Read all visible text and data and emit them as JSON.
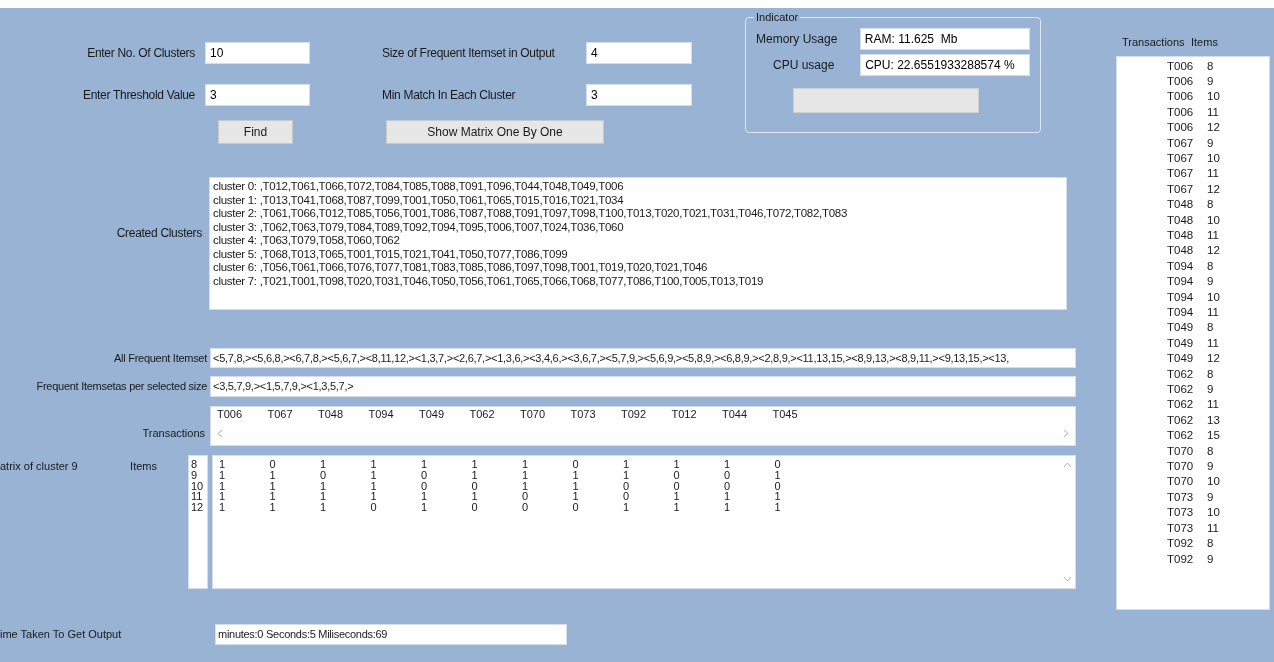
{
  "form": {
    "fields": [
      {
        "label": "Enter No. Of Clusters",
        "value": "10"
      },
      {
        "label": "Size of Frequent Itemset in Output",
        "value": "4"
      },
      {
        "label": "Enter Threshold Value",
        "value": "3"
      },
      {
        "label": "Min Match In Each Cluster",
        "value": "3"
      }
    ],
    "buttons": [
      "Find",
      "Show Matrix One By One"
    ]
  },
  "indicator": {
    "title": "Indicator",
    "memory_label": "Memory Usage",
    "memory_value": "RAM: 11.625  Mb",
    "cpu_label": "CPU usage",
    "cpu_value": "CPU: 22.6551933288574 %",
    "progress": {
      "level": 0
    }
  },
  "clusters": {
    "label": "Created Clusters",
    "lines": [
      "cluster 0: ,T012,T061,T066,T072,T084,T085,T088,T091,T096,T044,T048,T049,T006",
      "cluster 1: ,T013,T041,T068,T087,T099,T001,T050,T061,T065,T015,T016,T021,T034",
      "cluster 2: ,T061,T066,T012,T085,T056,T001,T086,T087,T088,T091,T097,T098,T100,T013,T020,T021,T031,T046,T072,T082,T083",
      "cluster 3: ,T062,T063,T079,T084,T089,T092,T094,T095,T006,T007,T024,T036,T060",
      "cluster 4: ,T063,T079,T058,T060,T062",
      "cluster 5: ,T068,T013,T065,T001,T015,T021,T041,T050,T077,T086,T099",
      "cluster 6: ,T056,T061,T066,T076,T077,T081,T083,T085,T086,T097,T098,T001,T019,T020,T021,T046",
      "cluster 7: ,T021,T001,T098,T020,T031,T046,T050,T056,T061,T065,T066,T068,T077,T086,T100,T005,T013,T019"
    ]
  },
  "all_frequent": {
    "label": "All Frequent Itemset",
    "value": "<5,7,8,><5,6,8,><6,7,8,><5,6,7,><8,11,12,><1,3,7,><2,6,7,><1,3,6,><3,4,6,><3,6,7,><5,7,9,><5,6,9,><5,8,9,><6,8,9,><2,8,9,><11,13,15,><8,9,13,><8,9,11,><9,13,15,><13,"
  },
  "selected_size": {
    "label": "Frequent Itemsetas per selected size",
    "value": "<3,5,7,9,><1,5,7,9,><1,3,5,7,>"
  },
  "transactions": {
    "label": "Transactions",
    "columns": [
      "T006",
      "T067",
      "T048",
      "T094",
      "T049",
      "T062",
      "T070",
      "T073",
      "T092",
      "T012",
      "T044",
      "T045"
    ]
  },
  "matrix": {
    "label": "atrix of cluster 9",
    "items_label": "Items",
    "items": [
      "8",
      "9",
      "10",
      "11",
      "12"
    ],
    "rows": [
      [
        "1",
        "0",
        "1",
        "1",
        "1",
        "1",
        "1",
        "0",
        "1",
        "1",
        "1",
        "0"
      ],
      [
        "1",
        "1",
        "0",
        "1",
        "0",
        "1",
        "1",
        "1",
        "1",
        "0",
        "0",
        "1"
      ],
      [
        "1",
        "1",
        "1",
        "1",
        "0",
        "0",
        "1",
        "1",
        "0",
        "0",
        "0",
        "0"
      ],
      [
        "1",
        "1",
        "1",
        "1",
        "1",
        "1",
        "0",
        "1",
        "0",
        "1",
        "1",
        "1"
      ],
      [
        "1",
        "1",
        "1",
        "0",
        "1",
        "0",
        "0",
        "0",
        "1",
        "1",
        "1",
        "1"
      ]
    ]
  },
  "time": {
    "label": "ime Taken To Get Output",
    "value": "minutes:0 Seconds:5 Miliseconds:69"
  },
  "transaction_list": {
    "headers": [
      "Transactions",
      "Items"
    ],
    "rows": [
      [
        "T006",
        "8"
      ],
      [
        "T006",
        "9"
      ],
      [
        "T006",
        "10"
      ],
      [
        "T006",
        "11"
      ],
      [
        "T006",
        "12"
      ],
      [
        "T067",
        "9"
      ],
      [
        "T067",
        "10"
      ],
      [
        "T067",
        "11"
      ],
      [
        "T067",
        "12"
      ],
      [
        "T048",
        "8"
      ],
      [
        "T048",
        "10"
      ],
      [
        "T048",
        "11"
      ],
      [
        "T048",
        "12"
      ],
      [
        "T094",
        "8"
      ],
      [
        "T094",
        "9"
      ],
      [
        "T094",
        "10"
      ],
      [
        "T094",
        "11"
      ],
      [
        "T049",
        "8"
      ],
      [
        "T049",
        "11"
      ],
      [
        "T049",
        "12"
      ],
      [
        "T062",
        "8"
      ],
      [
        "T062",
        "9"
      ],
      [
        "T062",
        "11"
      ],
      [
        "T062",
        "13"
      ],
      [
        "T062",
        "15"
      ],
      [
        "T070",
        "8"
      ],
      [
        "T070",
        "9"
      ],
      [
        "T070",
        "10"
      ],
      [
        "T073",
        "9"
      ],
      [
        "T073",
        "10"
      ],
      [
        "T073",
        "11"
      ],
      [
        "T092",
        "8"
      ],
      [
        "T092",
        "9"
      ]
    ]
  }
}
